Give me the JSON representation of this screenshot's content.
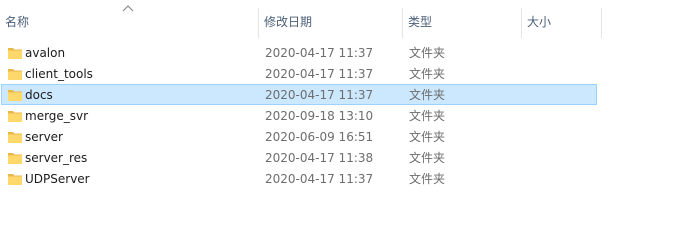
{
  "columns": {
    "name": "名称",
    "modified": "修改日期",
    "type": "类型",
    "size": "大小"
  },
  "sort_indicator": "chevron-up-icon",
  "colors": {
    "selected_bg": "#cce8ff",
    "selected_border": "#99d1ff",
    "folder": "#ffd86b",
    "header_text": "#4c607a"
  },
  "rows": [
    {
      "name": "avalon",
      "modified": "2020-04-17 11:37",
      "type": "文件夹",
      "size": "",
      "selected": false
    },
    {
      "name": "client_tools",
      "modified": "2020-04-17 11:37",
      "type": "文件夹",
      "size": "",
      "selected": false
    },
    {
      "name": "docs",
      "modified": "2020-04-17 11:37",
      "type": "文件夹",
      "size": "",
      "selected": true
    },
    {
      "name": "merge_svr",
      "modified": "2020-09-18 13:10",
      "type": "文件夹",
      "size": "",
      "selected": false
    },
    {
      "name": "server",
      "modified": "2020-06-09 16:51",
      "type": "文件夹",
      "size": "",
      "selected": false
    },
    {
      "name": "server_res",
      "modified": "2020-04-17 11:38",
      "type": "文件夹",
      "size": "",
      "selected": false
    },
    {
      "name": "UDPServer",
      "modified": "2020-04-17 11:37",
      "type": "文件夹",
      "size": "",
      "selected": false
    }
  ]
}
